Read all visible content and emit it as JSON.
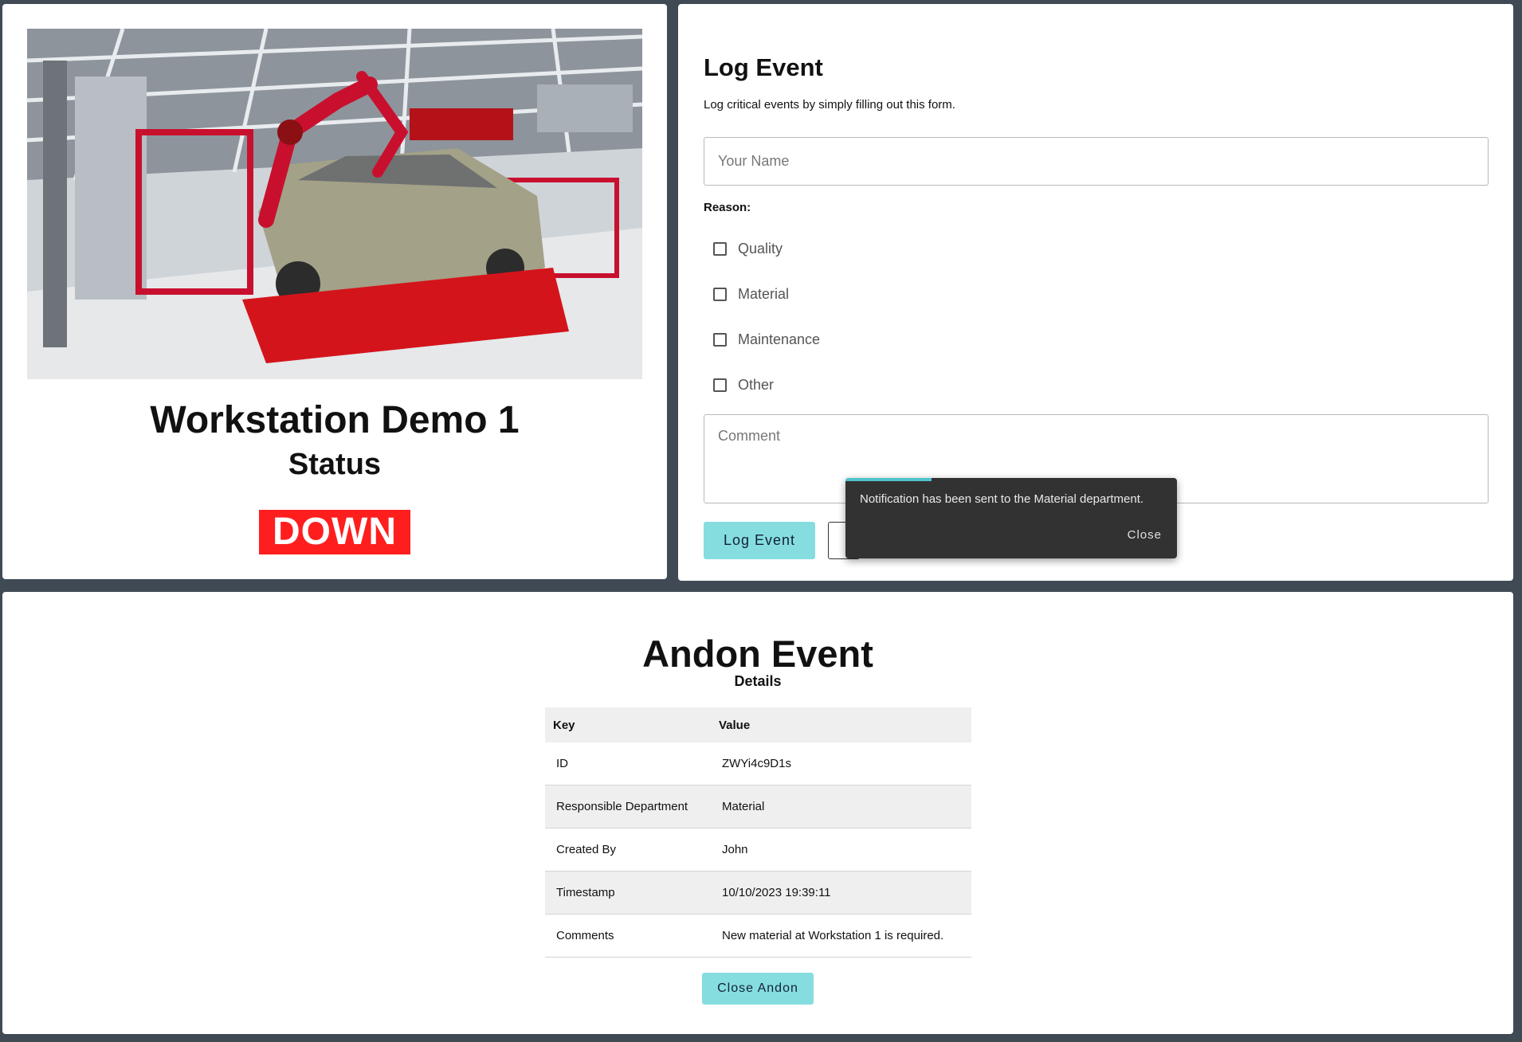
{
  "status_panel": {
    "workstation_name": "Workstation Demo 1",
    "status_label": "Status",
    "status_value": "DOWN",
    "status_color": "#ff1e1e"
  },
  "log_form": {
    "title": "Log Event",
    "description": "Log critical events by simply filling out this form.",
    "name_placeholder": "Your Name",
    "reason_label": "Reason:",
    "reasons": [
      "Quality",
      "Material",
      "Maintenance",
      "Other"
    ],
    "comment_placeholder": "Comment",
    "submit_label": "Log Event",
    "accent_color": "#86dde0"
  },
  "snackbar": {
    "message": "Notification has been sent to the Material department.",
    "close_label": "Close",
    "progress": 0.26
  },
  "andon_event": {
    "title": "Andon Event",
    "subtitle": "Details",
    "columns": [
      "Key",
      "Value"
    ],
    "rows": [
      {
        "key": "ID",
        "value": "ZWYi4c9D1s"
      },
      {
        "key": "Responsible Department",
        "value": "Material"
      },
      {
        "key": "Created By",
        "value": "John"
      },
      {
        "key": "Timestamp",
        "value": "10/10/2023 19:39:11"
      },
      {
        "key": "Comments",
        "value": "New material at Workstation 1 is required."
      }
    ],
    "close_label": "Close Andon"
  }
}
